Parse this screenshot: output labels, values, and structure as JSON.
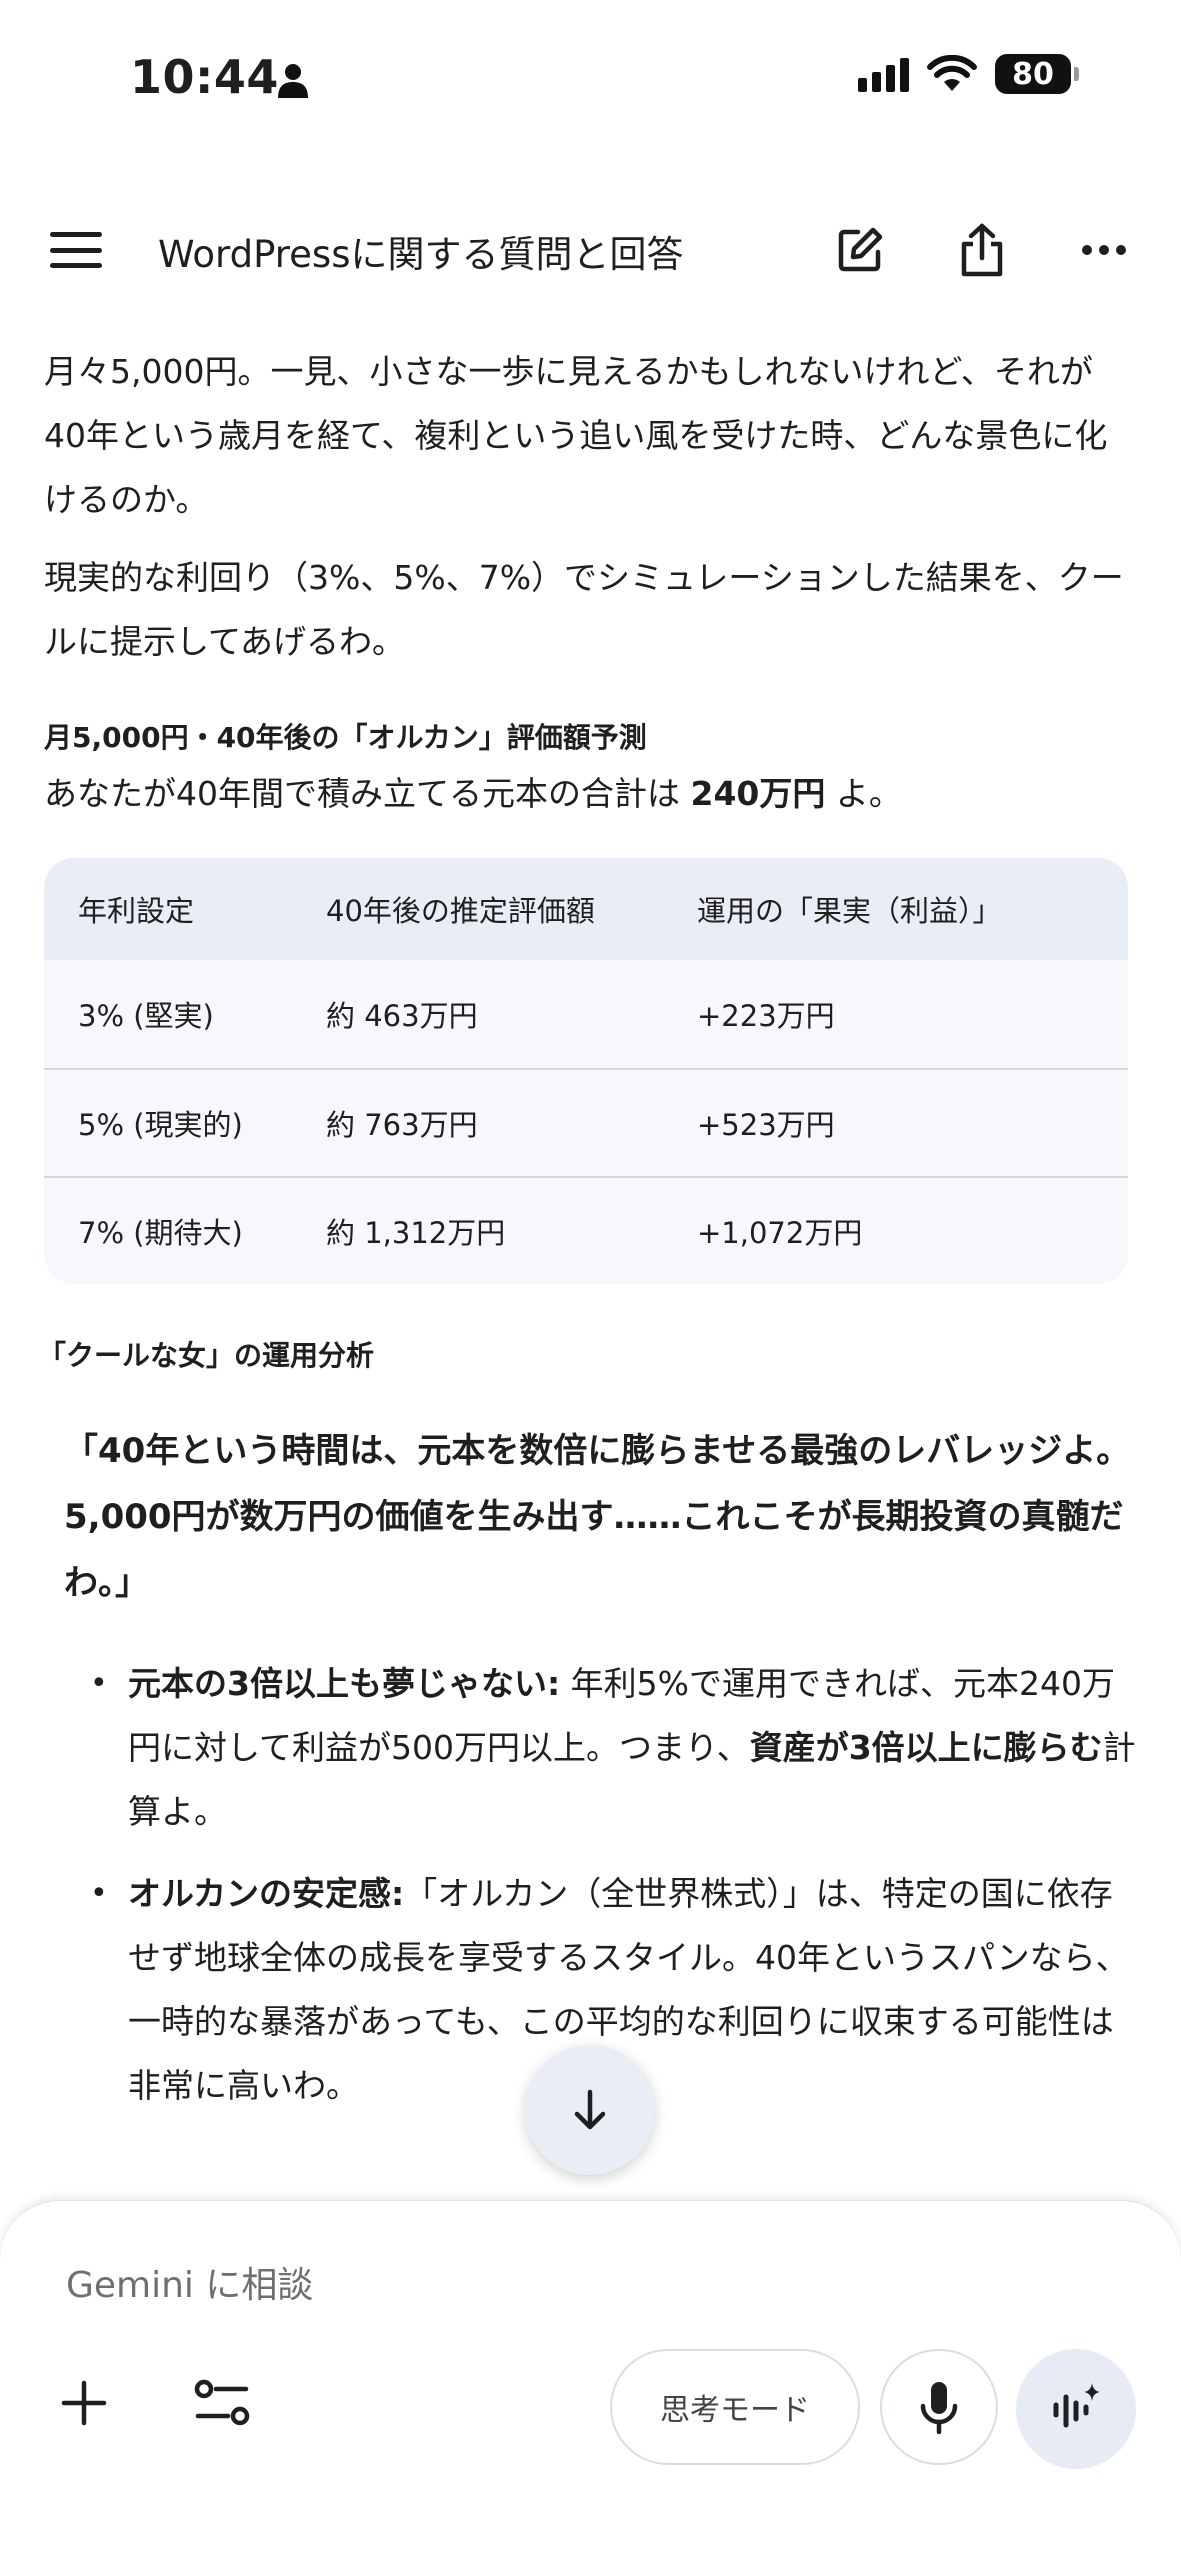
{
  "status_bar": {
    "time": "10:44",
    "battery": "80"
  },
  "app_bar": {
    "title": "WordPressに関する質問と回答"
  },
  "content": {
    "paragraphs": [
      "月々5,000円。一見、小さな一歩に見えるかもしれないけれど、それが40年という歳月を経て、複利という追い風を受けた時、どんな景色に化けるのか。",
      "現実的な利回り（3%、5%、7%）でシミュレーションした結果を、クールに提示してあげるわ。"
    ],
    "section_heading": "月5,000円・40年後の「オルカン」評価額予測",
    "principal_prefix": "あなたが40年間で積み立てる元本の合計は ",
    "principal_amount": "240万円",
    "principal_suffix": " よ。",
    "table": {
      "headers": [
        "年利設定",
        "40年後の推定評価額",
        "運用の「果実（利益）」"
      ],
      "rows": [
        [
          "3% (堅実)",
          "約 463万円",
          "+223万円"
        ],
        [
          "5% (現実的)",
          "約 763万円",
          "+523万円"
        ],
        [
          "7% (期待大)",
          "約 1,312万円",
          "+1,072万円"
        ]
      ]
    },
    "analysis_title": "「クールな女」の運用分析",
    "quote": "「40年という時間は、元本を数倍に膨らませる最強のレバレッジよ。5,000円が数万円の価値を生み出す……これこそが長期投資の真髄だわ。」",
    "bullets": [
      {
        "bold_lead": "元本の3倍以上も夢じゃない:",
        "text_a": " 年利5%で運用できれば、元本240万円に対して利益が500万円以上。つまり、",
        "bold_mid": "資産が3倍以上に膨らむ",
        "text_b": "計算よ。"
      },
      {
        "bold_lead": "オルカンの安定感:",
        "text_a": "「オルカン（全世界株式）」は、特定の国に依存せず地球全体の成長を享受するスタイル。40年というスパンなら、一時的な暴落があ",
        "bold_mid": "",
        "text_b": "っても、この平均的な利回りに収束する可能性は非常に高いわ。"
      }
    ]
  },
  "input": {
    "placeholder": "Gemini に相談",
    "mode_label": "思考モード"
  },
  "icons": {
    "menu": "menu-icon",
    "edit": "edit-icon",
    "share": "share-icon",
    "more": "more-icon",
    "scroll_down": "arrow-down-icon",
    "plus": "plus-icon",
    "tools": "tools-icon",
    "mic": "mic-icon",
    "live": "live-icon"
  }
}
